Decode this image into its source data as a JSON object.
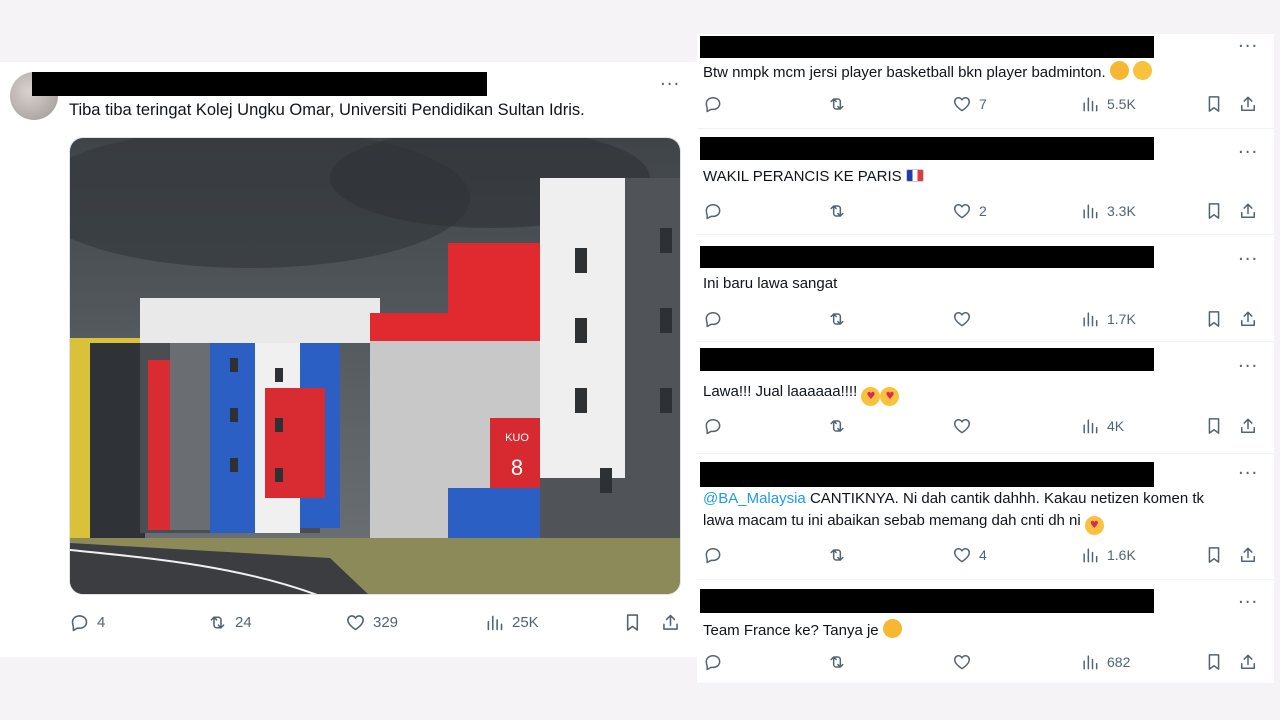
{
  "main_tweet": {
    "text": "Tiba tiba teringat Kolej Ungku Omar, Universiti Pendidikan Sultan Idris.",
    "more": "···",
    "photo": {
      "sign_text": "KUO",
      "sign_number": "8"
    },
    "actions": {
      "replies": "4",
      "reposts": "24",
      "likes": "329",
      "views": "25K"
    }
  },
  "replies": [
    {
      "text": "Btw nmpk mcm jersi player basketball bkn player badminton.",
      "emoji_1": "🤭",
      "emoji_2": "😅",
      "replies": "",
      "reposts": "",
      "likes": "7",
      "views": "5.5K"
    },
    {
      "text": "WAKIL PERANCIS KE PARIS",
      "emoji_1": "🇫🇷",
      "replies": "",
      "reposts": "",
      "likes": "2",
      "views": "3.3K"
    },
    {
      "text": "Ini baru lawa sangat",
      "replies": "",
      "reposts": "",
      "likes": "",
      "views": "1.7K"
    },
    {
      "text": "Lawa!!! Jual laaaaaa!!!!",
      "emoji_1": "😍",
      "emoji_2": "😍",
      "replies": "",
      "reposts": "",
      "likes": "",
      "views": "4K"
    },
    {
      "mention": "@BA_Malaysia",
      "text_line1": " CANTIKNYA. Ni dah cantik dahhh. Kakau netizen komen tk",
      "text_line2": "lawa macam tu ini abaikan sebab memang dah cnti dh ni",
      "emoji_1": "😍",
      "replies": "",
      "reposts": "",
      "likes": "4",
      "views": "1.6K"
    },
    {
      "text": "Team France ke? Tanya je",
      "emoji_1": "🤭",
      "replies": "",
      "reposts": "",
      "likes": "",
      "views": "682"
    }
  ],
  "icons": {
    "reply": "reply-icon",
    "repost": "repost-icon",
    "like": "heart-icon",
    "views": "views-icon",
    "bookmark": "bookmark-icon",
    "share": "share-icon"
  },
  "colors": {
    "text": "#0f1419",
    "secondary": "#536471",
    "link": "#1d9bf0",
    "redaction": "#000000"
  }
}
